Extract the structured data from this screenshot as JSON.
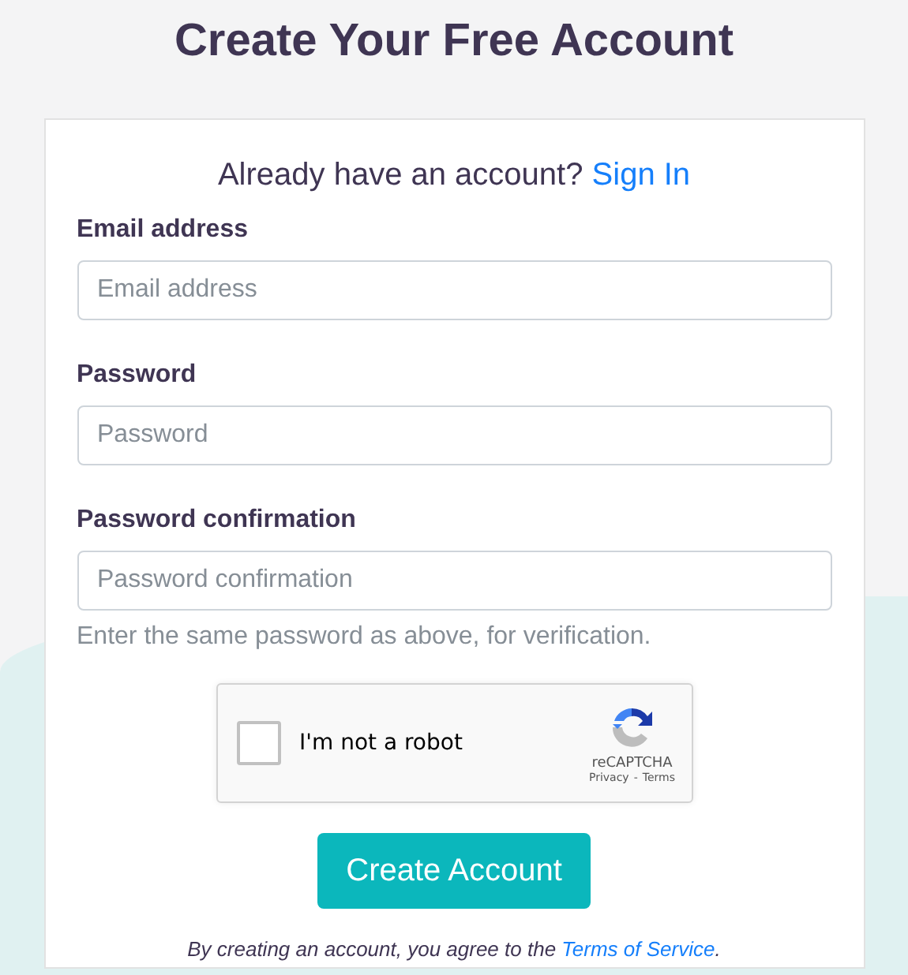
{
  "title": "Create Your Free Account",
  "signin": {
    "prompt": "Already have an account?",
    "link": "Sign In"
  },
  "fields": [
    {
      "label": "Email address",
      "placeholder": "Email address"
    },
    {
      "label": "Password",
      "placeholder": "Password"
    },
    {
      "label": "Password confirmation",
      "placeholder": "Password confirmation",
      "help": "Enter the same password as above, for verification."
    }
  ],
  "captcha": {
    "checked": false,
    "label": "I'm not a robot",
    "brand": "reCAPTCHA",
    "privacy": "Privacy",
    "separator": "-",
    "terms": "Terms"
  },
  "submit": "Create Account",
  "agreement": {
    "prefix": "By creating an account, you agree to the",
    "link": "Terms of Service",
    "suffix": "."
  }
}
